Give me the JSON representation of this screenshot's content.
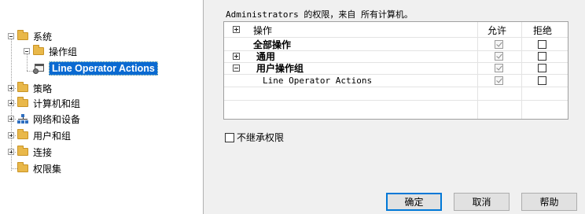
{
  "tree": {
    "items": [
      {
        "label": "系统"
      },
      {
        "label": "操作组"
      },
      {
        "label": "Line Operator Actions"
      },
      {
        "label": "策略"
      },
      {
        "label": "计算机和组"
      },
      {
        "label": "网络和设备"
      },
      {
        "label": "用户和组"
      },
      {
        "label": "连接"
      },
      {
        "label": "权限集"
      }
    ],
    "selected": "Line Operator Actions"
  },
  "permissions": {
    "title": "Administrators 的权限，来自 所有计算机。",
    "columns": {
      "operation": "操作",
      "allow": "允许",
      "deny": "拒绝"
    },
    "rows": [
      {
        "label": "全部操作",
        "allow": "checked-disabled",
        "deny": "unchecked"
      },
      {
        "label": "通用",
        "allow": "checked-disabled",
        "deny": "unchecked"
      },
      {
        "label": "用户操作组",
        "allow": "checked-disabled",
        "deny": "unchecked"
      },
      {
        "label": "Line Operator Actions",
        "allow": "checked-disabled",
        "deny": "unchecked"
      }
    ]
  },
  "inherit": {
    "label": "不继承权限",
    "checked": false
  },
  "buttons": {
    "ok": "确定",
    "cancel": "取消",
    "help": "帮助"
  }
}
